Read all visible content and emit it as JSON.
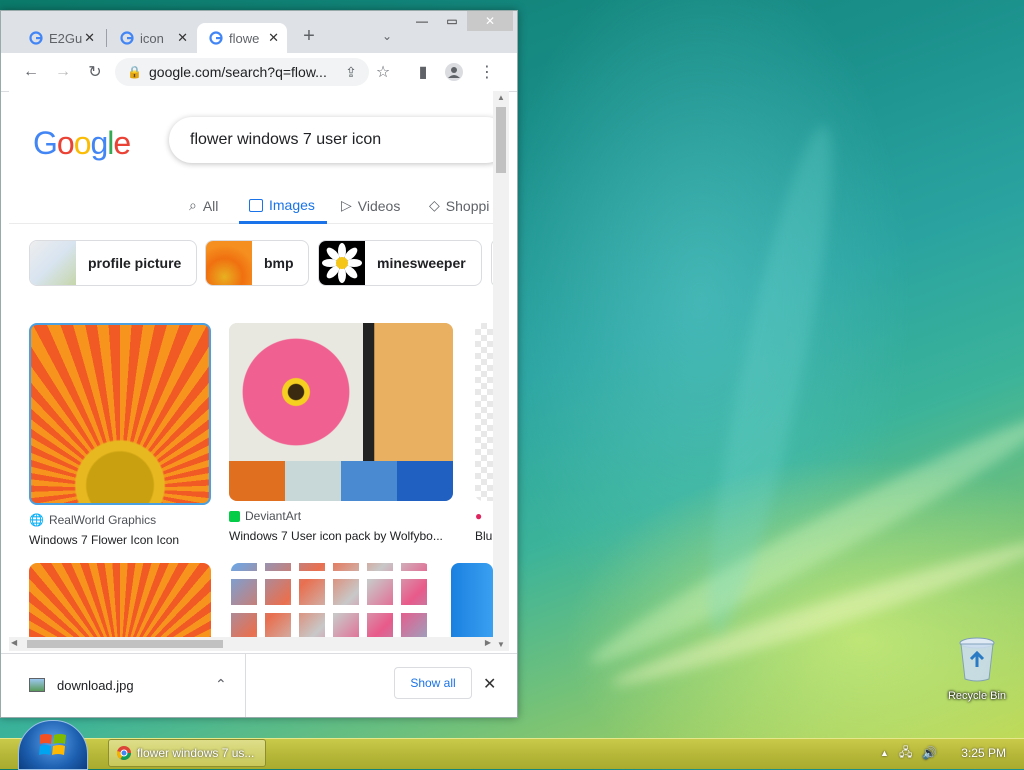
{
  "browser": {
    "tabs": [
      {
        "label": "E2Gu",
        "icon": "google-icon"
      },
      {
        "label": "icon",
        "icon": "google-icon"
      },
      {
        "label": "flowe",
        "icon": "google-icon"
      }
    ],
    "url": "google.com/search?q=flow..."
  },
  "search": {
    "logo": "Google",
    "query": "flower windows 7 user icon",
    "nav_tabs": [
      "All",
      "Images",
      "Videos",
      "Shoppi"
    ],
    "active_tab": "Images",
    "chips": [
      "profile picture",
      "bmp",
      "minesweeper"
    ]
  },
  "results": [
    {
      "source": "RealWorld Graphics",
      "title": "Windows 7 Flower Icon Icon"
    },
    {
      "source": "DeviantArt",
      "title": "Windows 7 User icon pack by Wolfybo..."
    },
    {
      "source": "",
      "title": "Blu"
    }
  ],
  "download_bar": {
    "file": "download.jpg",
    "show_all": "Show all"
  },
  "desktop": {
    "recycle_bin": "Recycle Bin"
  },
  "taskbar": {
    "window_label": "flower windows 7 us...",
    "clock": "3:25 PM"
  }
}
